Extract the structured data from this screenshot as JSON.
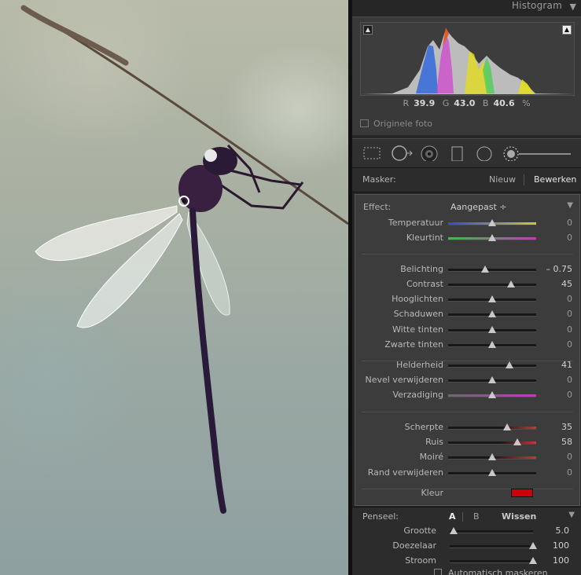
{
  "histogram": {
    "title": "Histogram",
    "readout": {
      "r_label": "R",
      "r_value": "39.9",
      "g_label": "G",
      "g_value": "43.0",
      "b_label": "B",
      "b_value": "40.6",
      "unit": "%"
    },
    "original_photo_label": "Originele foto"
  },
  "mask": {
    "label": "Masker:",
    "new_label": "Nieuw",
    "edit_label": "Bewerken"
  },
  "effect": {
    "label": "Effect:",
    "value": "Aangepast ÷"
  },
  "groups": [
    [
      {
        "label": "Temperatuur",
        "value": "0",
        "level": 0.5,
        "track": "temp"
      },
      {
        "label": "Kleurtint",
        "value": "0",
        "level": 0.5,
        "track": "tint"
      }
    ],
    [
      {
        "label": "Belichting",
        "value": "– 0.75",
        "level": 0.42,
        "track": "plain"
      },
      {
        "label": "Contrast",
        "value": "45",
        "level": 0.71,
        "track": "plain"
      },
      {
        "label": "Hooglichten",
        "value": "0",
        "level": 0.5,
        "track": "plain"
      },
      {
        "label": "Schaduwen",
        "value": "0",
        "level": 0.5,
        "track": "plain"
      },
      {
        "label": "Witte tinten",
        "value": "0",
        "level": 0.5,
        "track": "plain"
      },
      {
        "label": "Zwarte tinten",
        "value": "0",
        "level": 0.5,
        "track": "plain"
      }
    ],
    [
      {
        "label": "Helderheid",
        "value": "41",
        "level": 0.7,
        "track": "plain"
      },
      {
        "label": "Nevel verwijderen",
        "value": "0",
        "level": 0.5,
        "track": "plain"
      },
      {
        "label": "Verzadiging",
        "value": "0",
        "level": 0.5,
        "track": "sat"
      }
    ],
    [
      {
        "label": "Scherpte",
        "value": "35",
        "level": 0.67,
        "track": "sharp"
      },
      {
        "label": "Ruis",
        "value": "58",
        "level": 0.79,
        "track": "noise"
      },
      {
        "label": "Moiré",
        "value": "0",
        "level": 0.5,
        "track": "moire"
      },
      {
        "label": "Rand verwijderen",
        "value": "0",
        "level": 0.5,
        "track": "plain"
      }
    ]
  ],
  "color": {
    "label": "Kleur",
    "swatch": "#cc0008"
  },
  "brush": {
    "label": "Penseel:",
    "a_label": "A",
    "b_label": "B",
    "erase_label": "Wissen",
    "sliders": [
      {
        "label": "Grootte",
        "value": "5.0",
        "level": 0.05
      },
      {
        "label": "Doezelaar",
        "value": "100",
        "level": 1.0
      },
      {
        "label": "Stroom",
        "value": "100",
        "level": 1.0
      }
    ],
    "auto_mask_label": "Automatisch maskeren"
  },
  "icons": [
    "crop-icon",
    "spot-removal-icon",
    "redeye-icon",
    "graduated-filter-icon",
    "radial-filter-icon",
    "adjustment-brush-icon"
  ]
}
